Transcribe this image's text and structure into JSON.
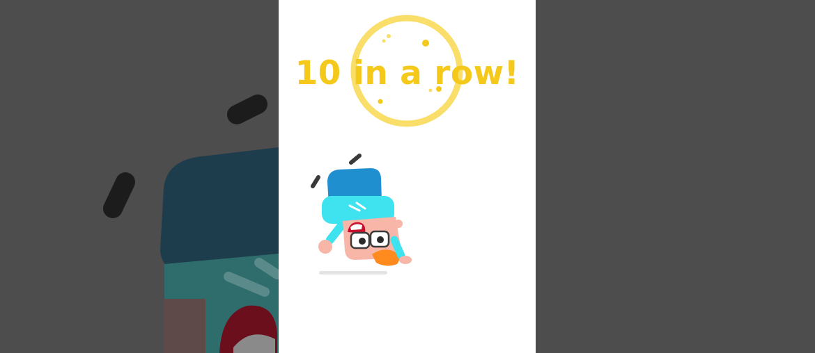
{
  "celebration": {
    "streak_text": "10 in a row!"
  },
  "colors": {
    "accent_yellow": "#f5c91c",
    "ring_yellow": "#f9df6a",
    "hat_blue": "#1f8fd0",
    "hat_cyan": "#3fe3f0",
    "skin": "#f7b6a8",
    "hair_orange": "#ff8a1e",
    "mouth_red": "#c8102e",
    "background_dark": "#4d4d4d"
  },
  "icons": [
    "motion-lines-icon",
    "progress-ring-icon",
    "character-illustration"
  ]
}
